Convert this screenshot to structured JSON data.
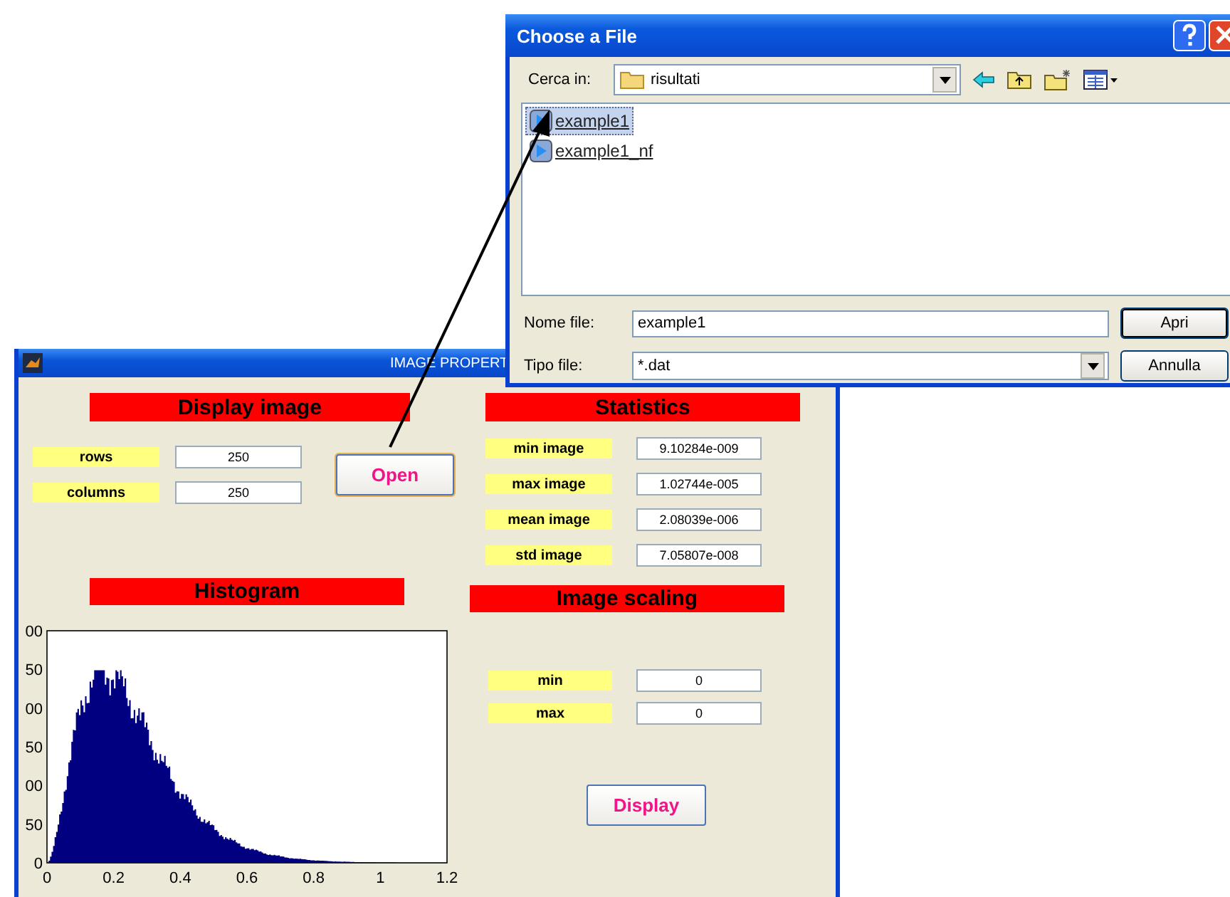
{
  "dialog": {
    "title": "Choose a File",
    "look_in": {
      "label": "Cerca in:",
      "value": "risultati"
    },
    "files": [
      {
        "name": "example1",
        "selected": true
      },
      {
        "name": "example1_nf",
        "selected": false
      }
    ],
    "file_name": {
      "label": "Nome file:",
      "value": "example1"
    },
    "file_type": {
      "label": "Tipo file:",
      "value": "*.dat"
    },
    "buttons": [
      "Apri",
      "Annulla"
    ]
  },
  "window": {
    "title": "IMAGE PROPERT",
    "display_image": {
      "heading": "Display image",
      "fields": [
        {
          "label": "rows",
          "value": "250"
        },
        {
          "label": "columns",
          "value": "250"
        }
      ],
      "button": "Open"
    },
    "statistics": {
      "heading": "Statistics",
      "fields": [
        {
          "label": "min image",
          "value": "9.10284e-009"
        },
        {
          "label": "max image",
          "value": "1.02744e-005"
        },
        {
          "label": "mean image",
          "value": "2.08039e-006"
        },
        {
          "label": "std image",
          "value": "7.05807e-008"
        }
      ]
    },
    "histogram": {
      "heading": "Histogram",
      "y_tick_labels": [
        "00",
        "50",
        "00",
        "50",
        "00",
        "50",
        "0"
      ],
      "x_tick_labels": [
        "0",
        "0.2",
        "0.4",
        "0.6",
        "0.8",
        "1",
        "1.2"
      ]
    },
    "image_scaling": {
      "heading": "Image scaling",
      "fields": [
        {
          "label": "min",
          "value": "0"
        },
        {
          "label": "max",
          "value": "0"
        }
      ],
      "button": "Display"
    }
  }
}
